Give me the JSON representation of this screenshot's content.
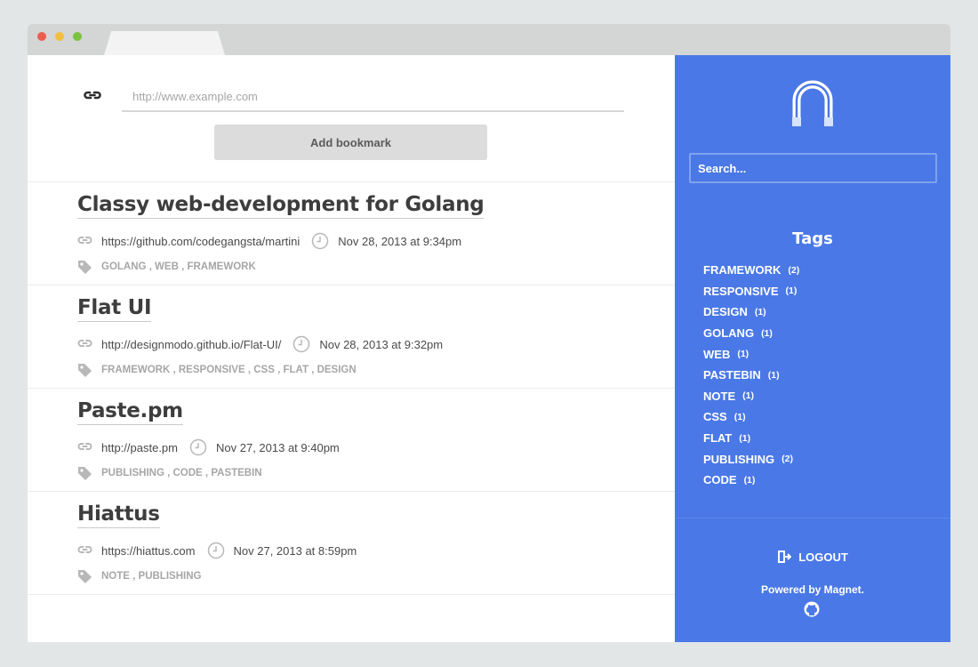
{
  "add_form": {
    "url_placeholder": "http://www.example.com",
    "add_button_label": "Add bookmark"
  },
  "bookmarks": [
    {
      "title": "Classy web-development for Golang",
      "url": "https://github.com/codegangsta/martini",
      "date": "Nov 28, 2013 at 9:34pm",
      "tags": "GOLANG , WEB , FRAMEWORK"
    },
    {
      "title": "Flat UI",
      "url": "http://designmodo.github.io/Flat-UI/",
      "date": "Nov 28, 2013 at 9:32pm",
      "tags": "FRAMEWORK , RESPONSIVE , CSS , FLAT , DESIGN"
    },
    {
      "title": "Paste.pm",
      "url": "http://paste.pm",
      "date": "Nov 27, 2013 at 9:40pm",
      "tags": "PUBLISHING , CODE , PASTEBIN"
    },
    {
      "title": "Hiattus",
      "url": "https://hiattus.com",
      "date": "Nov 27, 2013 at 8:59pm",
      "tags": "NOTE , PUBLISHING"
    }
  ],
  "sidebar": {
    "search_placeholder": "Search...",
    "tags_title": "Tags",
    "tags": [
      {
        "name": "FRAMEWORK",
        "count": "(2)"
      },
      {
        "name": "RESPONSIVE",
        "count": "(1)"
      },
      {
        "name": "DESIGN",
        "count": "(1)"
      },
      {
        "name": "GOLANG",
        "count": "(1)"
      },
      {
        "name": "WEB",
        "count": "(1)"
      },
      {
        "name": "PASTEBIN",
        "count": "(1)"
      },
      {
        "name": "NOTE",
        "count": "(1)"
      },
      {
        "name": "CSS",
        "count": "(1)"
      },
      {
        "name": "FLAT",
        "count": "(1)"
      },
      {
        "name": "PUBLISHING",
        "count": "(2)"
      },
      {
        "name": "CODE",
        "count": "(1)"
      }
    ],
    "logout_label": "LOGOUT",
    "powered_by": "Powered by Magnet."
  },
  "colors": {
    "sidebar_bg": "#4a78e6",
    "title_text": "#3d3d3d",
    "tag_text": "#a6a6a6",
    "button_bg": "#dcdcdc"
  },
  "icons": [
    "link-icon",
    "clock-icon",
    "tag-icon",
    "magnet-logo-icon",
    "logout-icon",
    "github-icon"
  ]
}
